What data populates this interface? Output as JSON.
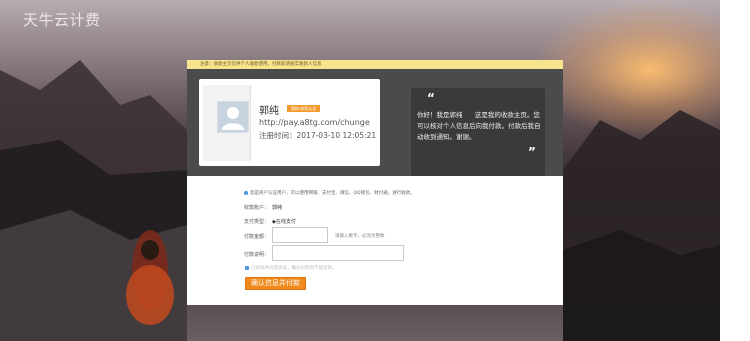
{
  "header": {
    "logo_text": "天牛云计费"
  },
  "notice": {
    "text": "注意：收款主页仅供个人收款使用，付款前请核实收款人信息"
  },
  "profile": {
    "name": "郭纯",
    "badge": "郭纯·收款认证",
    "url": "http://pay.a8tg.com/chunge",
    "register_label": "注册时间：",
    "register_time": "2017-03-10 12:05:21"
  },
  "quote": {
    "open_mark": "“",
    "close_mark": "”",
    "text": "你好！我是郭纯      这是我的收款主页。您可以核对个人信息后向我付款。付款后我自动收到通知。谢谢。"
  },
  "form": {
    "info_icon": "i",
    "info_text": "您是商户认证用户，可以使用网银、支付宝、微信、QQ钱包、财付通，进行收款。",
    "payee_label": "收款账户：",
    "payee_value": "郭纯",
    "paytype_label": "支付类型：",
    "paytype_value": "◆在线支付",
    "amount_label": "付款金额：",
    "amount_value": "",
    "amount_hint": "请输入数字，必须为整数",
    "note_label": "付款说明：",
    "note_value": "",
    "agree_check": "✓",
    "agree_text": "已阅读并同意协议，确认付款后不能退款。",
    "submit_label": "确认信息并付款"
  },
  "colors": {
    "accent": "#f08a1c",
    "notice_bg": "#f7e58e",
    "badge": "#f59b2e",
    "panel_dark": "#4b4b4d"
  },
  "icons": {
    "avatar": "user-avatar-icon",
    "info": "info-icon",
    "checkbox": "checkbox-checked-icon"
  }
}
